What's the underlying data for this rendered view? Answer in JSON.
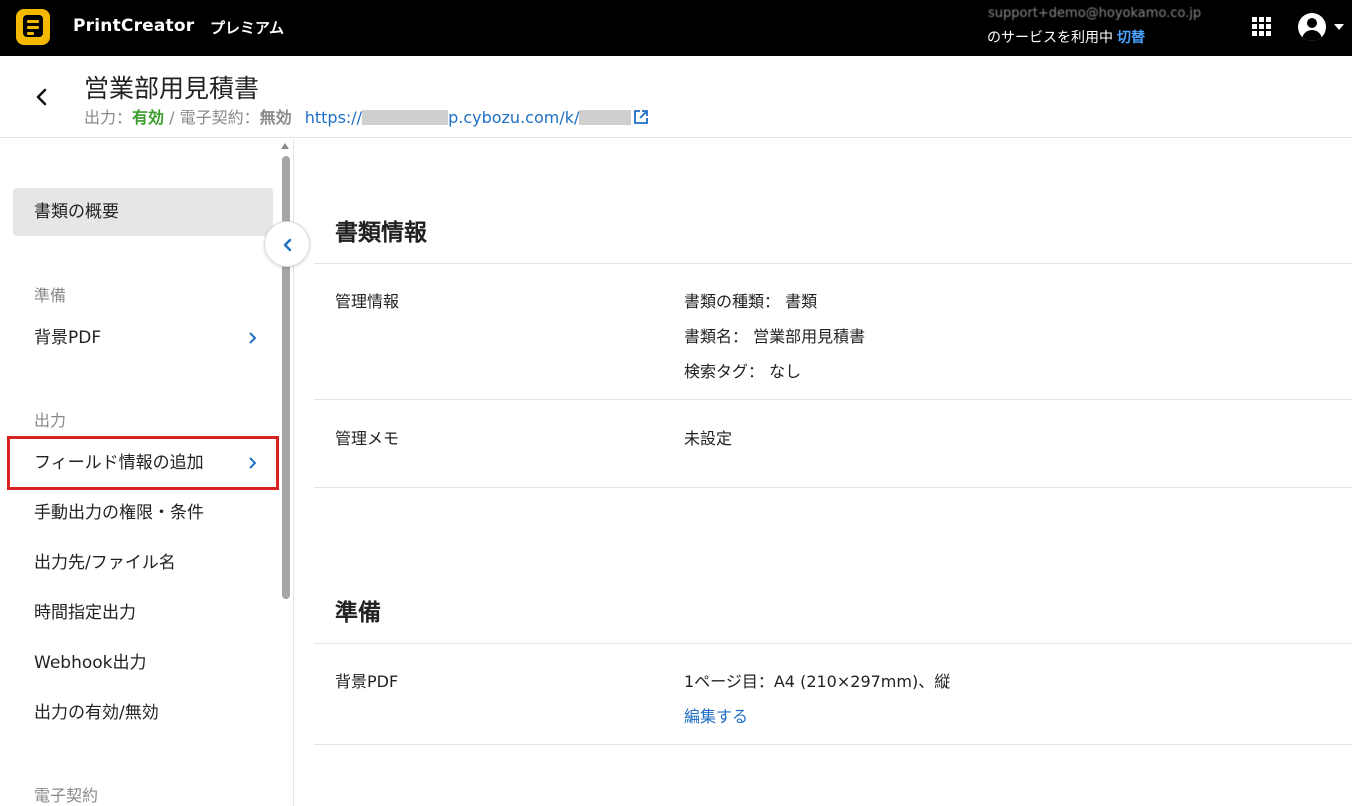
{
  "topbar": {
    "brand": "PrintCreator",
    "plan": "プレミアム",
    "account_email": "support+demo@hoyokamo.co.jp",
    "account_status": "のサービスを利用中",
    "switch_label": "切替"
  },
  "header": {
    "title": "営業部用見積書",
    "output_label": "出力：",
    "output_value": "有効",
    "separator": " / ",
    "contract_label": "電子契約：",
    "contract_value": "無効",
    "url_prefix": "https://",
    "url_middle": "p.cybozu.com/k/"
  },
  "sidebar": {
    "overview": "書類の概要",
    "group_prep": "準備",
    "bg_pdf": "背景PDF",
    "group_output": "出力",
    "field_info": "フィールド情報の追加",
    "manual_output": "手動出力の権限・条件",
    "output_dest": "出力先/ファイル名",
    "scheduled": "時間指定出力",
    "webhook": "Webhook出力",
    "output_toggle": "出力の有効/無効",
    "group_contract": "電子契約"
  },
  "main": {
    "doc_info": {
      "title": "書類情報",
      "mgmt_label": "管理情報",
      "type_line": "書類の種類： 書類",
      "name_line": "書類名： 営業部用見積書",
      "tag_line": "検索タグ： なし",
      "memo_label": "管理メモ",
      "memo_value": "未設定"
    },
    "prep": {
      "title": "準備",
      "bg_label": "背景PDF",
      "bg_value": "1ページ目：A4 (210×297mm)、縦",
      "edit_link": "編集する"
    }
  },
  "colors": {
    "topbar": "#000000",
    "accent": "#1f6fc4",
    "enabled": "#3a9c2b",
    "highlight": "#d92323",
    "logo": "#f5b800"
  }
}
